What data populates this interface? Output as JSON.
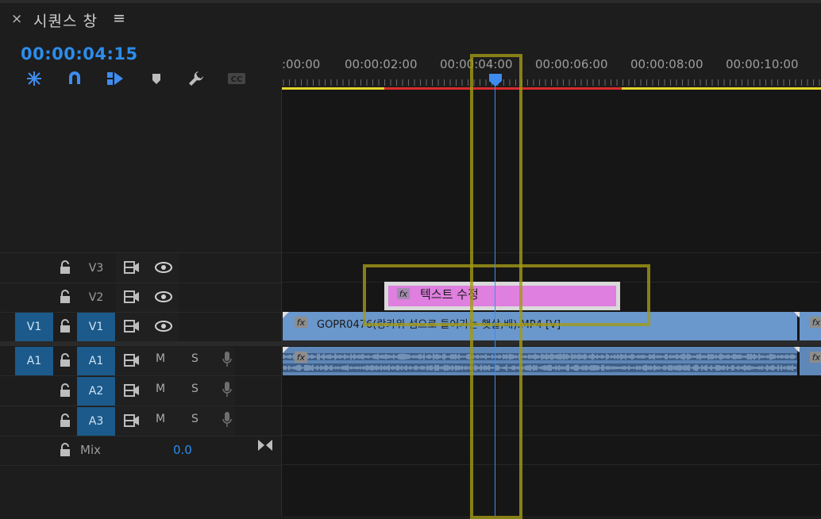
{
  "panel": {
    "close_glyph": "×",
    "title": "시퀀스 창",
    "menu_glyph": "≡",
    "timecode": "00:00:04:15"
  },
  "toolbar": {
    "icons": [
      "insert-overwrite-icon",
      "snap-magnet-icon",
      "linked-selection-icon",
      "add-marker-icon",
      "wrench-settings-icon",
      "captions-cc-icon"
    ],
    "cc_label": "CC"
  },
  "ruler": {
    "labels": [
      ":00:00",
      "00:00:02:00",
      "00:00:04:00",
      "00:00:06:00",
      "00:00:08:00",
      "00:00:10:00"
    ]
  },
  "tracks": {
    "v3": "V3",
    "v2": "V2",
    "v1_source": "V1",
    "v1": "V1",
    "a1_source": "A1",
    "a1": "A1",
    "a2": "A2",
    "a3": "A3",
    "m": "M",
    "s": "S"
  },
  "clips": {
    "text_clip": "텍스트 수정",
    "video_clip": "GOPR0476(랑카위 섬으로 들어가는 햇살,배).MP4 [V]",
    "fx": "fx"
  },
  "mix": {
    "label": "Mix",
    "value": "0.0"
  },
  "colors": {
    "accent_blue": "#2d8ceb",
    "track_active": "#1b5a8a",
    "video_clip": "#6a97cc",
    "text_clip": "#df7fdf",
    "highlight": "#a39a17",
    "workbar_red": "#d92c2c",
    "workbar_yellow": "#e4d52c"
  }
}
